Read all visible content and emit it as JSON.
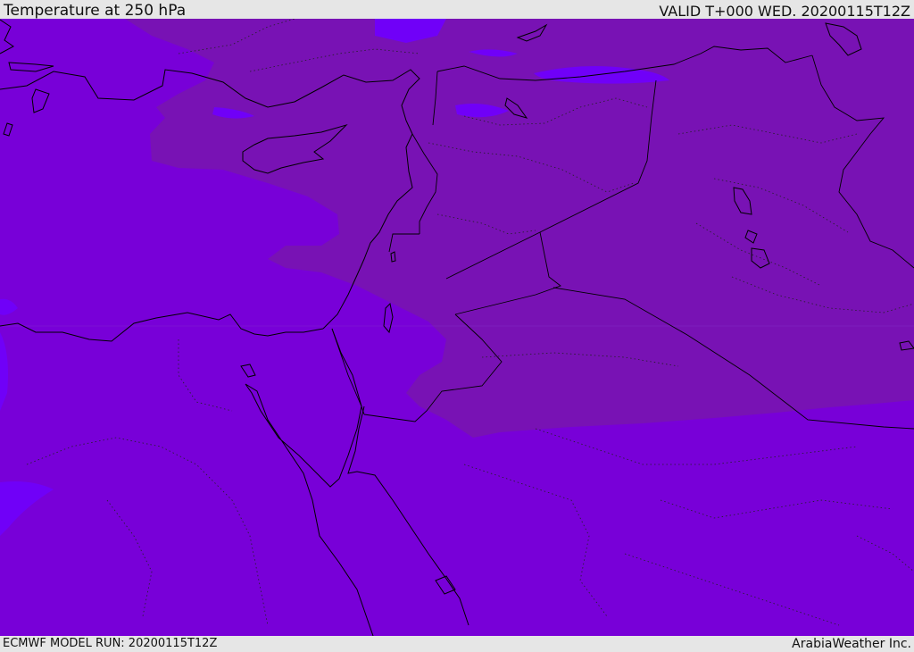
{
  "header": {
    "title": "Temperature at 250 hPa",
    "valid": "VALID T+000 WED. 20200115T12Z"
  },
  "footer": {
    "model_run": "ECMWF MODEL RUN: 20200115T12Z",
    "brand": "ArabiaWeather Inc."
  },
  "colors": {
    "base_field": "#7800d8",
    "warm_field": "#7812b4",
    "cold_field": "#7000f8",
    "coast": "#000000"
  }
}
